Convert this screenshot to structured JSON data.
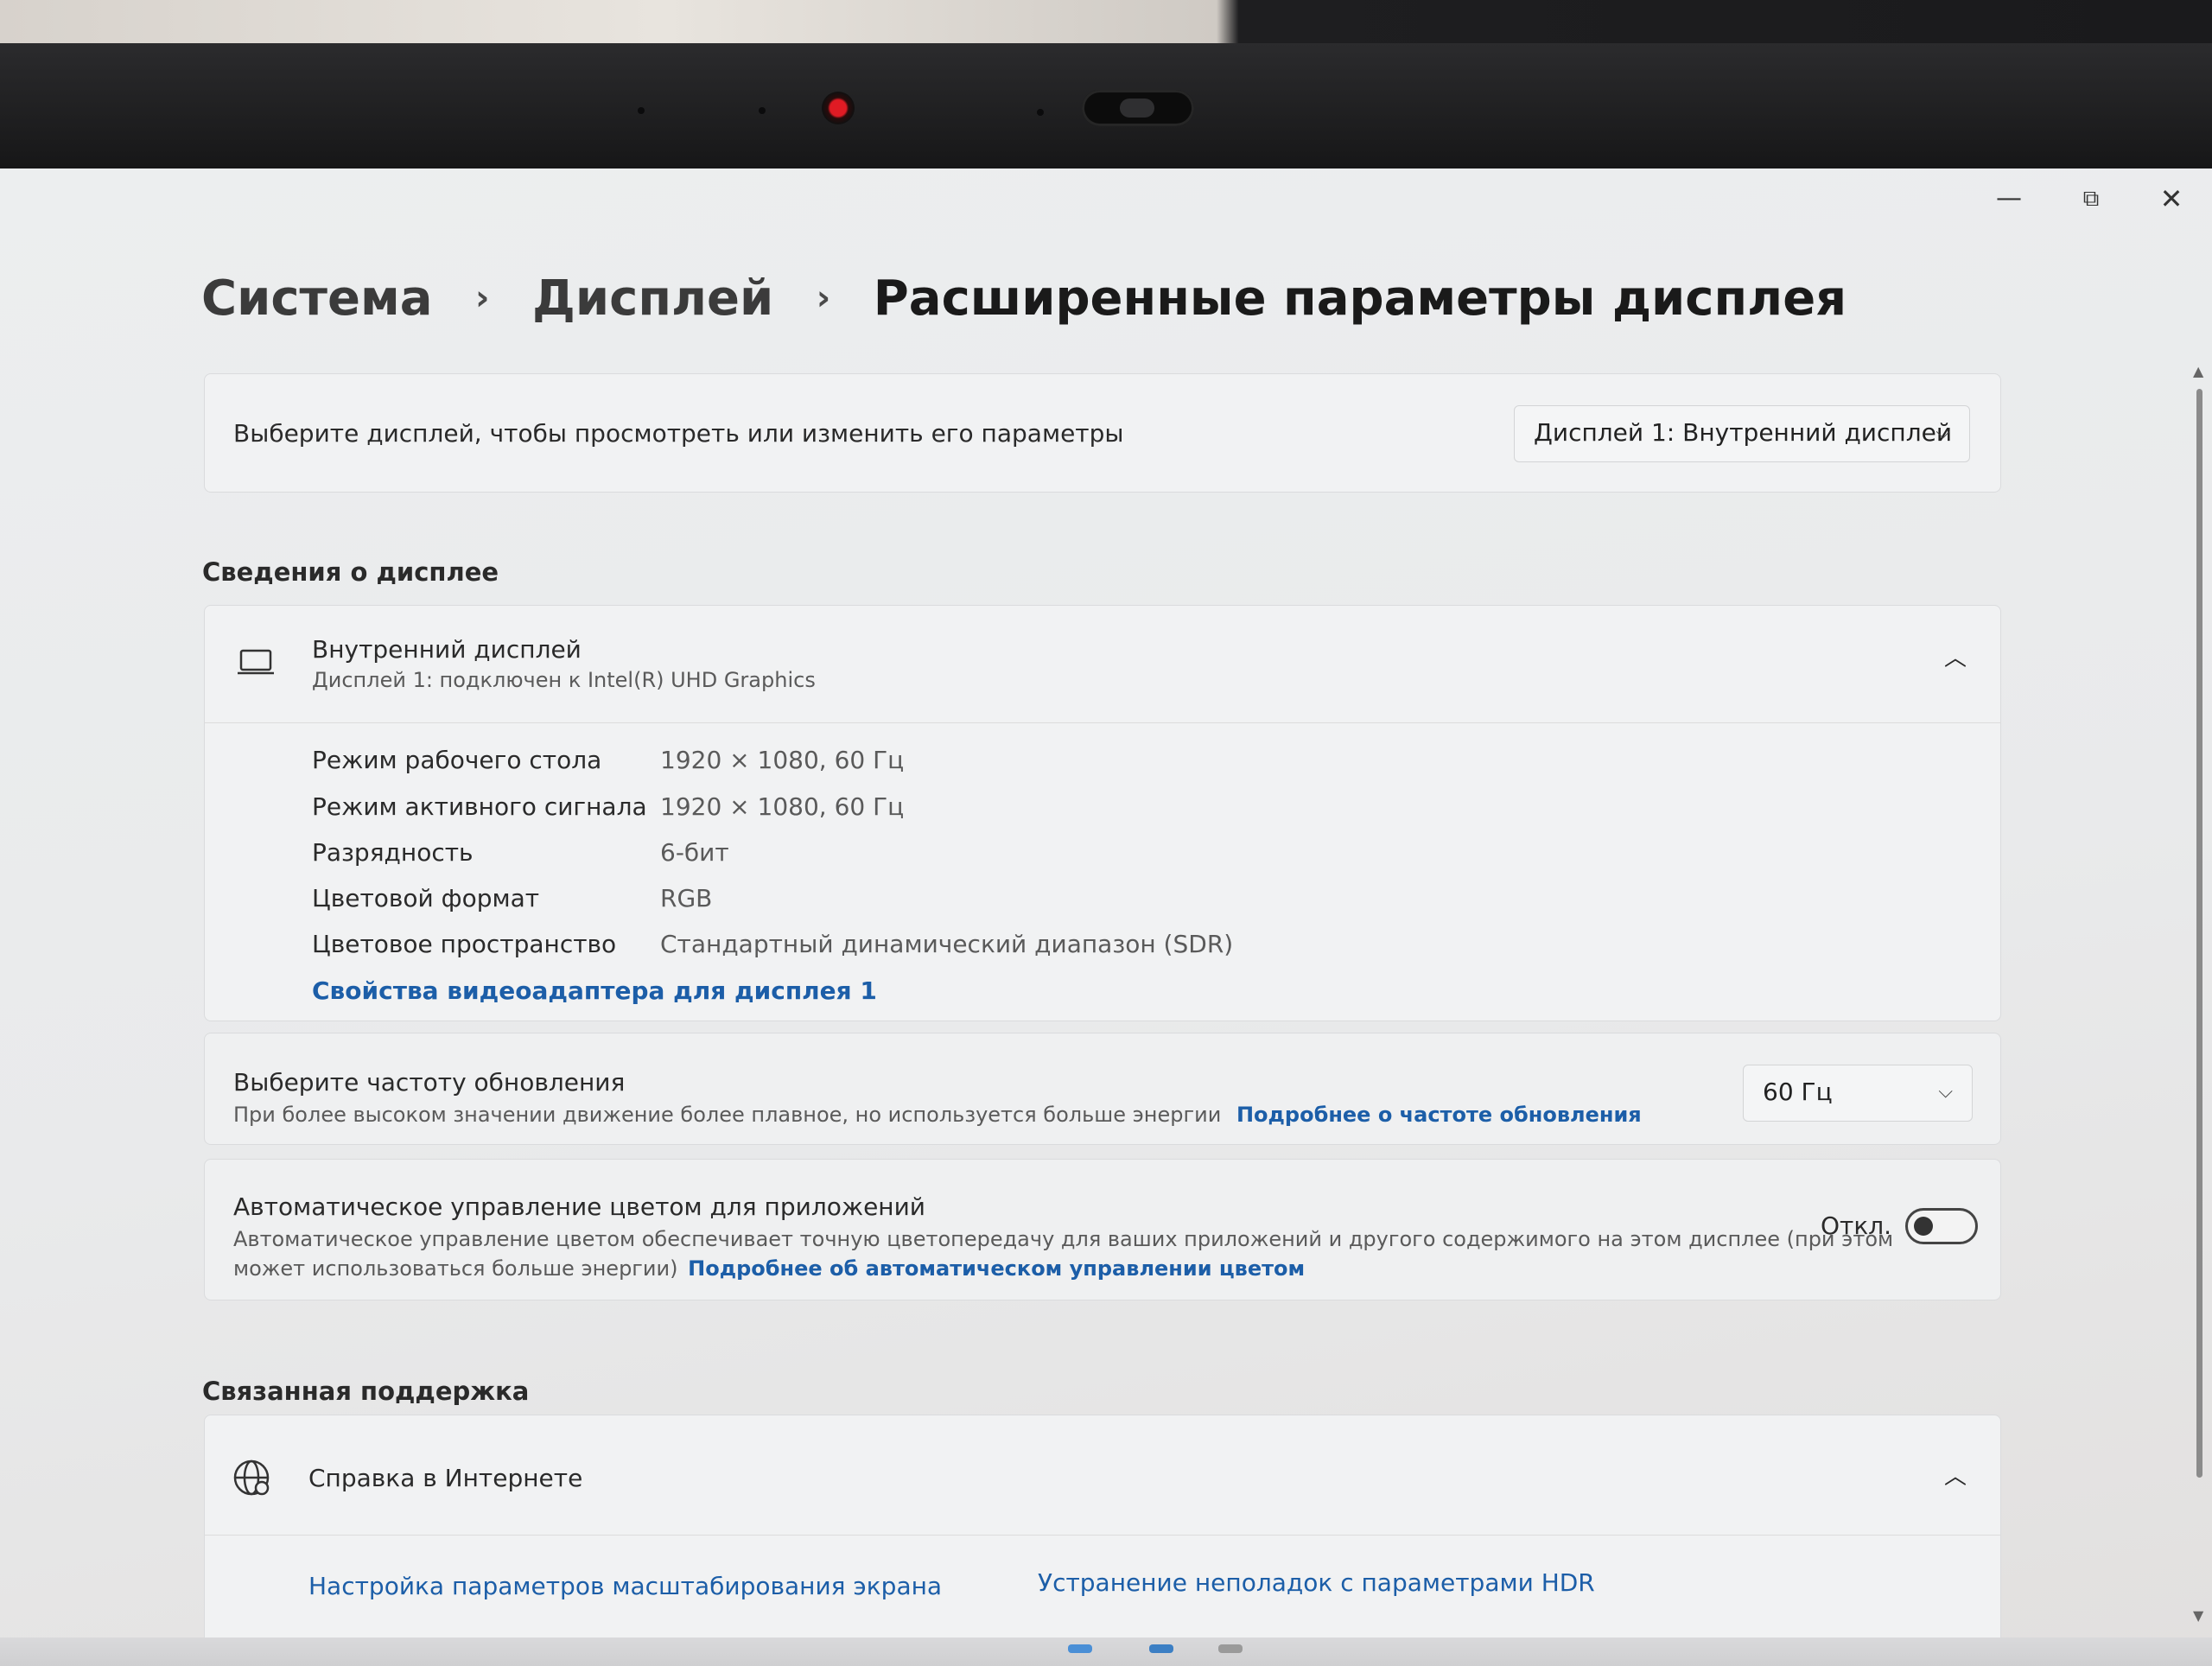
{
  "window": {
    "minimize_icon": "—",
    "restore_icon": "⧉",
    "close_icon": "✕"
  },
  "breadcrumb": {
    "items": [
      "Система",
      "Дисплей",
      "Расширенные параметры дисплея"
    ],
    "separator": "›"
  },
  "display_select": {
    "prompt": "Выберите дисплей, чтобы просмотреть или изменить его параметры",
    "selected": "Дисплей 1: Внутренний дисплей"
  },
  "display_info": {
    "section_title": "Сведения о дисплее",
    "title": "Внутренний дисплей",
    "subtitle": "Дисплей 1: подключен к Intel(R) UHD Graphics",
    "rows": [
      {
        "label": "Режим рабочего стола",
        "value": "1920 × 1080, 60 Гц"
      },
      {
        "label": "Режим активного сигнала",
        "value": "1920 × 1080, 60 Гц"
      },
      {
        "label": "Разрядность",
        "value": "6-бит"
      },
      {
        "label": "Цветовой формат",
        "value": "RGB"
      },
      {
        "label": "Цветовое пространство",
        "value": "Стандартный динамический диапазон (SDR)"
      }
    ],
    "adapter_link": "Свойства видеоадаптера для дисплея 1"
  },
  "refresh_rate": {
    "title": "Выберите частоту обновления",
    "description": "При более высоком значении движение более плавное, но используется больше энергии",
    "link": "Подробнее о частоте обновления",
    "selected": "60 Гц"
  },
  "auto_color": {
    "title": "Автоматическое управление цветом для приложений",
    "description_line1": "Автоматическое управление цветом обеспечивает точную цветопередачу для ваших приложений и другого содержимого на этом дисплее (при этом",
    "description_line2": "может использоваться больше энергии)",
    "link": "Подробнее об автоматическом управлении цветом",
    "state_label": "Откл.",
    "enabled": false
  },
  "support": {
    "section_title": "Связанная поддержка",
    "title": "Справка в Интернете",
    "links": [
      "Настройка параметров масштабирования экрана",
      "Устранение неполадок с параметрами HDR"
    ]
  },
  "colors": {
    "accent_link": "#1c5ea8",
    "background": "#ebeced",
    "card": "#f1f2f3"
  }
}
